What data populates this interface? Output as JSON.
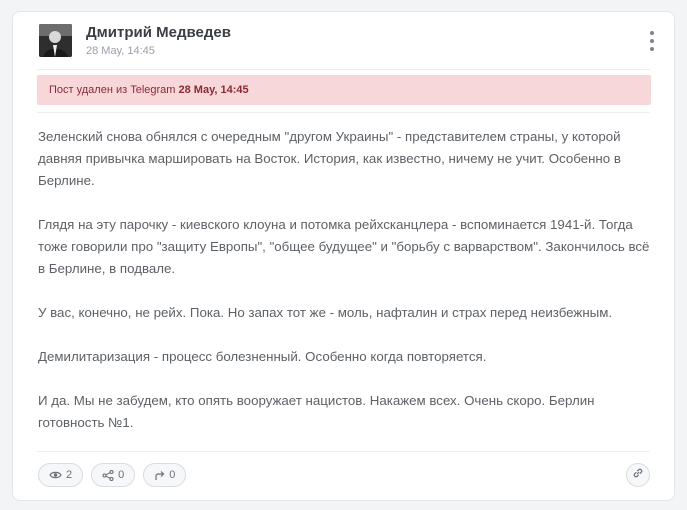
{
  "post": {
    "author": "Дмитрий Медведев",
    "date": "28 May, 14:45",
    "notice": {
      "prefix": "Пост удален из Telegram",
      "date": "28 May, 14:45"
    },
    "paragraphs": [
      "Зеленский снова обнялся с очередным \"другом Украины\" - представителем страны, у которой давняя привычка маршировать на Восток. История, как известно, ничему не учит. Особенно в Берлине.",
      "Глядя на эту парочку - киевского клоуна и потомка рейхсканцлера - вспоминается 1941-й. Тогда тоже говорили про \"защиту Европы\", \"общее будущее\" и \"борьбу с варварством\". Закончилось всё в Берлине, в подвале.",
      "У вас, конечно, не рейх. Пока. Но запах тот же - моль, нафталин и страх перед неизбежным.",
      "Демилитаризация - процесс болезненный. Особенно когда повторяется.",
      "И да. Мы не забудем, кто опять вооружает нацистов. Накажем всех. Очень скоро. Берлин готовность №1."
    ],
    "stats": {
      "views": "2",
      "shares": "0",
      "forwards": "0"
    },
    "icons": {
      "views": "eye-icon",
      "shares": "share-icon",
      "forwards": "forward-icon",
      "link": "link-icon",
      "menu": "more-vertical-icon"
    }
  }
}
